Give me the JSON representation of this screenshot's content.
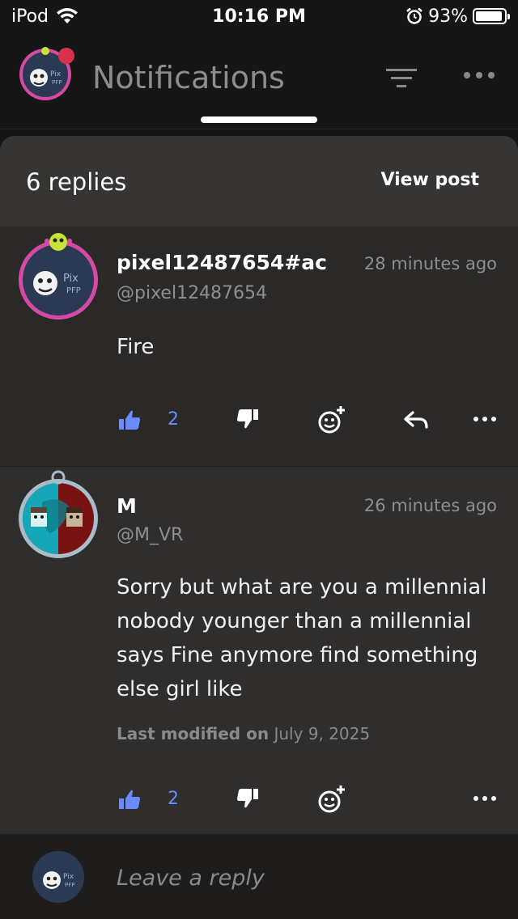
{
  "status_bar": {
    "carrier": "iPod",
    "time": "10:16 PM",
    "battery_percent": "93%",
    "battery_level": 0.93
  },
  "header": {
    "title": "Notifications",
    "filter_icon": "filter-icon",
    "more_icon": "more-horizontal-icon"
  },
  "sheet": {
    "replies_count": "6 replies",
    "view_post_label": "View post"
  },
  "comments": [
    {
      "author": "pixel12487654#ac",
      "handle": "@pixel12487654",
      "time": "28 minutes ago",
      "body": "Fire",
      "likes": "2"
    },
    {
      "author": "M",
      "handle": "@M_VR",
      "time": "26 minutes ago",
      "body": "Sorry but what are you a millennial nobody younger than a millennial says Fine anymore find something else girl like",
      "modified_label": "Last modified on",
      "modified_date": "July 9, 2025",
      "likes": "2"
    }
  ],
  "reply_bar": {
    "placeholder": "Leave a reply"
  },
  "colors": {
    "accent_blue": "#6b8cff",
    "background": "#161616",
    "sheet": "#2a2928",
    "notification_dot": "#d8314d"
  }
}
